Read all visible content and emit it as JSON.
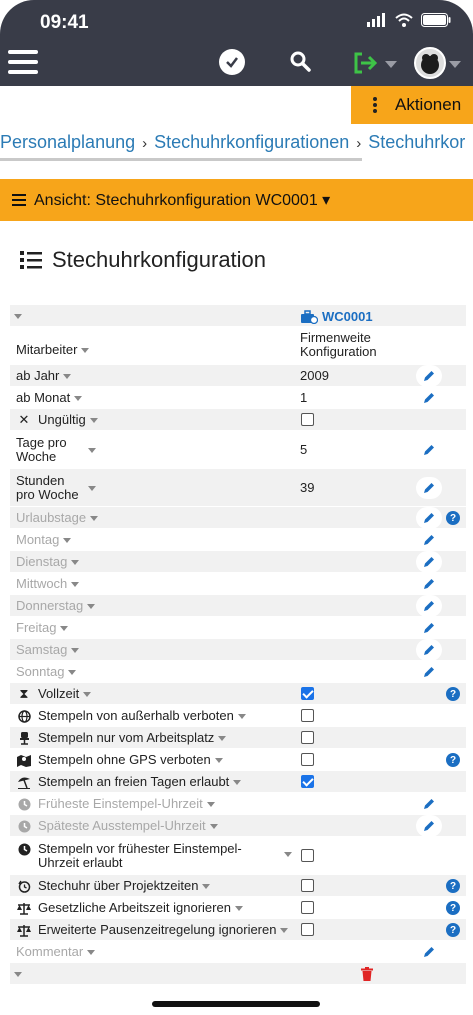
{
  "status": {
    "time": "09:41"
  },
  "header": {
    "menu_icon": "hamburger-icon",
    "check_icon": "clock-check-icon",
    "search_icon": "search-icon",
    "logout_icon": "logout-icon",
    "accent": "#393c48"
  },
  "actions": {
    "label": "Aktionen",
    "color": "#f7a51a"
  },
  "breadcrumb": [
    "Personalplanung",
    "Stechuhrkonfigurationen",
    "Stechuhrkor"
  ],
  "view_bar": {
    "label": "Ansicht: Stechuhrkonfiguration WC0001 ▾"
  },
  "page": {
    "title": "Stechuhrkonfiguration"
  },
  "table": {
    "record": "WC0001",
    "header_label": "Mitarbeiter",
    "header_value": "Firmenweite Konfiguration",
    "rows": [
      {
        "label": "ab Jahr",
        "value": "2009"
      },
      {
        "label": "ab Monat",
        "value": "1"
      },
      {
        "label": "Ungültig"
      },
      {
        "label": "Tage pro Woche",
        "value": "5"
      },
      {
        "label": "Stunden pro Woche",
        "value": "39"
      },
      {
        "label": "Urlaubstage"
      },
      {
        "label": "Montag"
      },
      {
        "label": "Dienstag"
      },
      {
        "label": "Mittwoch"
      },
      {
        "label": "Donnerstag"
      },
      {
        "label": "Freitag"
      },
      {
        "label": "Samstag"
      },
      {
        "label": "Sonntag"
      },
      {
        "label": "Vollzeit",
        "checked": true
      },
      {
        "label": "Stempeln von außerhalb verboten",
        "checked": false
      },
      {
        "label": "Stempeln nur vom Arbeitsplatz",
        "checked": false
      },
      {
        "label": "Stempeln ohne GPS verboten",
        "checked": false
      },
      {
        "label": "Stempeln an freien Tagen erlaubt",
        "checked": true
      },
      {
        "label": "Früheste Einstempel-Uhrzeit"
      },
      {
        "label": "Späteste Ausstempel-Uhrzeit"
      },
      {
        "label": "Stempeln vor frühester Einstempel-Uhrzeit erlaubt",
        "checked": false
      },
      {
        "label": "Stechuhr über Projektzeiten",
        "checked": false
      },
      {
        "label": "Gesetzliche Arbeitszeit ignorieren",
        "checked": false
      },
      {
        "label": "Erweiterte Pausenzeitregelung ignorieren",
        "checked": false
      },
      {
        "label": "Kommentar"
      }
    ]
  },
  "help_glyph": "?"
}
